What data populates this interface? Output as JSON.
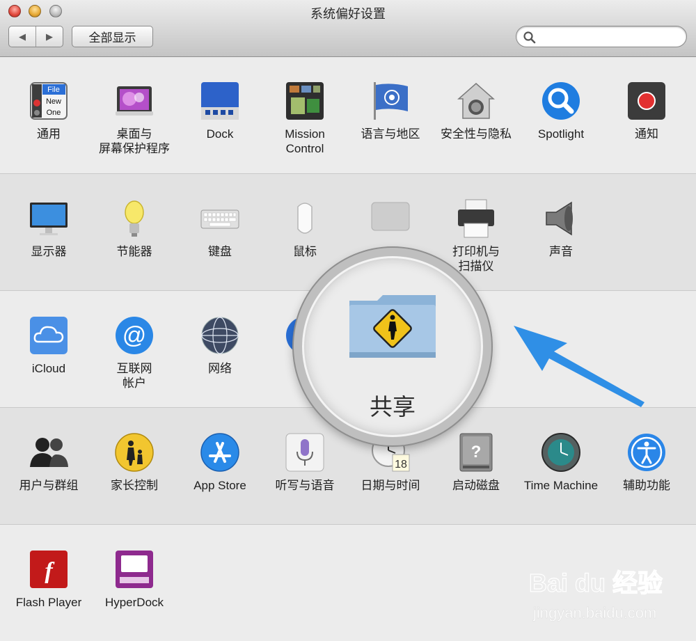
{
  "window": {
    "title": "系统偏好设置",
    "show_all_label": "全部显示",
    "back_glyph": "◀",
    "forward_glyph": "▶",
    "search": {
      "value": "",
      "placeholder": ""
    }
  },
  "sections": [
    {
      "items": [
        {
          "label": "通用",
          "icon": "general-icon"
        },
        {
          "label": "桌面与\n屏幕保护程序",
          "icon": "desktop-screensaver-icon"
        },
        {
          "label": "Dock",
          "icon": "dock-icon"
        },
        {
          "label": "Mission\nControl",
          "icon": "mission-control-icon"
        },
        {
          "label": "语言与地区",
          "icon": "language-region-icon"
        },
        {
          "label": "安全性与隐私",
          "icon": "security-privacy-icon"
        },
        {
          "label": "Spotlight",
          "icon": "spotlight-icon"
        },
        {
          "label": "通知",
          "icon": "notifications-icon"
        }
      ]
    },
    {
      "items": [
        {
          "label": "显示器",
          "icon": "displays-icon"
        },
        {
          "label": "节能器",
          "icon": "energy-saver-icon"
        },
        {
          "label": "键盘",
          "icon": "keyboard-icon"
        },
        {
          "label": "鼠标",
          "icon": "mouse-icon"
        },
        {
          "label": "",
          "icon": "trackpad-icon"
        },
        {
          "label": "打印机与\n扫描仪",
          "icon": "printers-scanners-icon"
        },
        {
          "label": "声音",
          "icon": "sound-icon"
        }
      ]
    },
    {
      "items": [
        {
          "label": "iCloud",
          "icon": "icloud-icon"
        },
        {
          "label": "互联网\n帐户",
          "icon": "internet-accounts-icon"
        },
        {
          "label": "网络",
          "icon": "network-icon"
        },
        {
          "label": "蓝",
          "icon": "bluetooth-icon"
        }
      ]
    },
    {
      "items": [
        {
          "label": "用户与群组",
          "icon": "users-groups-icon"
        },
        {
          "label": "家长控制",
          "icon": "parental-controls-icon"
        },
        {
          "label": "App Store",
          "icon": "app-store-icon"
        },
        {
          "label": "听写与语音",
          "icon": "dictation-speech-icon"
        },
        {
          "label": "日期与时间",
          "icon": "date-time-icon"
        },
        {
          "label": "启动磁盘",
          "icon": "startup-disk-icon"
        },
        {
          "label": "Time Machine",
          "icon": "time-machine-icon"
        },
        {
          "label": "辅助功能",
          "icon": "accessibility-icon"
        }
      ]
    },
    {
      "items": [
        {
          "label": "Flash Player",
          "icon": "flash-player-icon"
        },
        {
          "label": "HyperDock",
          "icon": "hyperdock-icon"
        }
      ]
    }
  ],
  "general_icon_text": {
    "line1": "File",
    "line2": "New",
    "line3": "One"
  },
  "date_icon_day": "18",
  "magnifier": {
    "label": "共享",
    "icon": "sharing-folder-icon"
  },
  "arrow_color": "#2f8fe6",
  "watermark": {
    "logo": "Bai du 经验",
    "url": "jingyan.baidu.com"
  }
}
